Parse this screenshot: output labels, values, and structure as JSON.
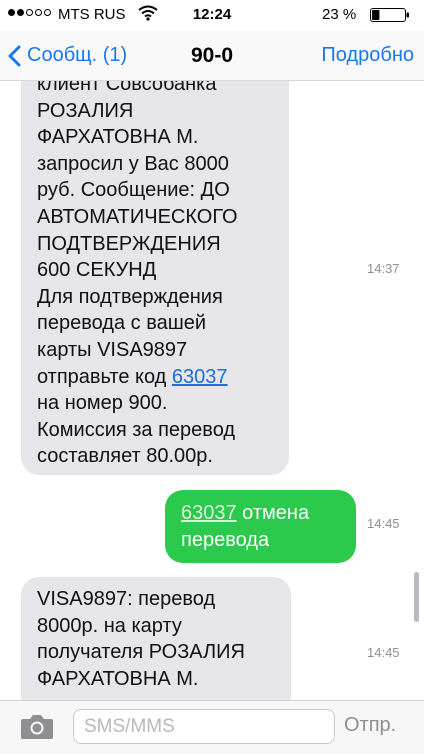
{
  "status_bar": {
    "carrier": "MTS RUS",
    "time": "12:24",
    "battery_percent": "23 %",
    "signal_bars_filled": 2,
    "signal_bars_total": 5,
    "battery_level": 0.23
  },
  "nav": {
    "back_label": "Сообщ. (1)",
    "title": "90-0",
    "details_label": "Подробно"
  },
  "messages": [
    {
      "direction": "incoming",
      "lines": [
        "клиент Совсобанка",
        "РОЗАЛИЯ",
        "ФАРХАТОВНА М.",
        "запросил у Вас 8000",
        "руб. Сообщение: ДО",
        "АВТОМАТИЧЕСКОГО",
        "ПОДТВЕРЖДЕНИЯ",
        "600 СЕКУНД",
        "Для подтверждения",
        "перевода с вашей",
        "карты VISA9897",
        "отправьте код ",
        "на номер 900.",
        "Комиссия за перевод",
        "составляет 80.00р."
      ],
      "code": "63037",
      "time": "14:37"
    },
    {
      "direction": "outgoing",
      "code": "63037",
      "line1_rest": " отмена",
      "line2": "перевода",
      "time": "14:45"
    },
    {
      "direction": "incoming",
      "lines": [
        "VISA9897: перевод",
        "8000р. на карту",
        "получателя РОЗАЛИЯ",
        "ФАРХАТОВНА М."
      ],
      "time": "14:45"
    }
  ],
  "input_bar": {
    "placeholder": "SMS/MMS",
    "send_label": "Отпр."
  },
  "colors": {
    "accent": "#1878f3",
    "incoming_bubble": "#e5e5ea",
    "outgoing_bubble": "#2bc94c"
  },
  "icons": [
    "wifi-icon",
    "battery-icon",
    "back-chevron-icon",
    "camera-icon"
  ]
}
